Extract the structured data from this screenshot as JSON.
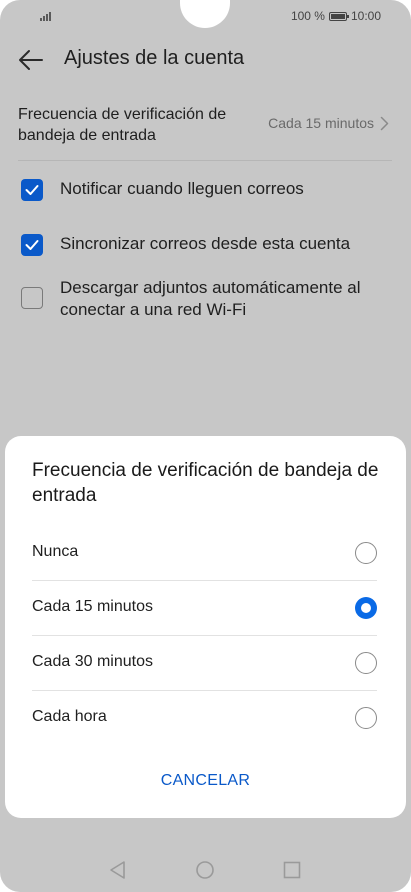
{
  "status_bar": {
    "battery_percent": "100 %",
    "time": "10:00"
  },
  "app_bar": {
    "title": "Ajustes de la cuenta"
  },
  "settings": {
    "frequency": {
      "label": "Frecuencia de verificación de bandeja de entrada",
      "value": "Cada 15 minutos"
    },
    "checkboxes": [
      {
        "label": "Notificar cuando lleguen correos",
        "checked": true
      },
      {
        "label": "Sincronizar correos desde esta cuenta",
        "checked": true
      },
      {
        "label": "Descargar adjuntos automáticamente al conectar a una red Wi-Fi",
        "checked": false
      }
    ]
  },
  "dialog": {
    "title": "Frecuencia de verificación de bandeja de entrada",
    "options": [
      {
        "label": "Nunca",
        "selected": false
      },
      {
        "label": "Cada 15 minutos",
        "selected": true
      },
      {
        "label": "Cada 30 minutos",
        "selected": false
      },
      {
        "label": "Cada hora",
        "selected": false
      }
    ],
    "cancel_label": "CANCELAR"
  },
  "colors": {
    "accent": "#0a59c9",
    "overlay": "#c7c7c7",
    "radio_selected": "#0a6ae6"
  },
  "icons": {
    "back": "arrow-left-icon",
    "chevron": "chevron-right-icon",
    "nav_back": "triangle-back-icon",
    "nav_home": "circle-home-icon",
    "nav_recents": "square-recents-icon"
  }
}
